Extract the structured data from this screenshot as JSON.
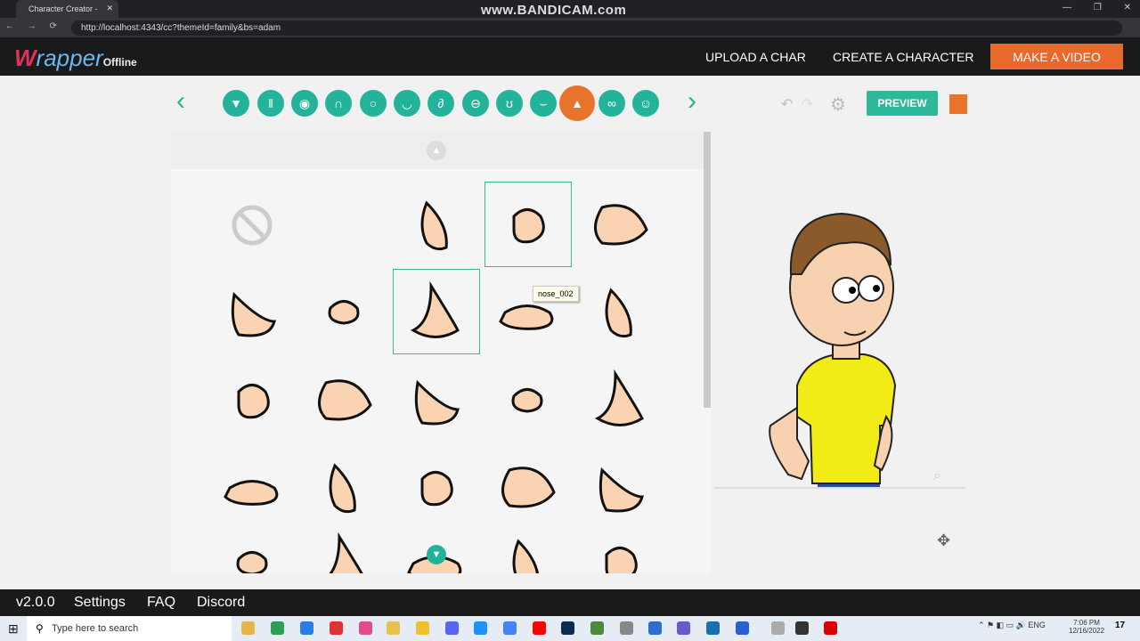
{
  "browser": {
    "tab_title": "Character Creator - ...",
    "url": "http://localhost:4343/cc?themeId=family&bs=adam",
    "overlay": "www.BANDICAM.com"
  },
  "header": {
    "logo": "Wrapper",
    "logo_suffix": "Offline",
    "buttons": [
      "UPLOAD A CHAR",
      "CREATE A CHARACTER",
      "MAKE A VIDEO"
    ],
    "accent": "#e8692b"
  },
  "toolbar": {
    "categories": [
      "shirt",
      "pants",
      "face",
      "hair",
      "beard",
      "mouth",
      "ear",
      "eye-shape",
      "eyes",
      "eyebrows",
      "nose",
      "glasses",
      "freckles"
    ],
    "selected": "nose",
    "preview_label": "PREVIEW",
    "accent": "#22b39a"
  },
  "picker": {
    "tooltip": "nose_002",
    "items_visible": 25
  },
  "footer": {
    "version": "v2.0.0",
    "links": [
      "Settings",
      "FAQ",
      "Discord"
    ]
  },
  "taskbar": {
    "search_placeholder": "Type here to search",
    "lang": "ENG",
    "time": "7:06 PM",
    "date": "12/16/2022",
    "notifications": "17"
  }
}
